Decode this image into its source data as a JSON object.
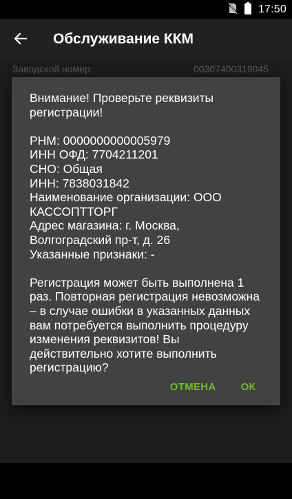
{
  "status_bar": {
    "time": "17:50"
  },
  "toolbar": {
    "title": "Обслуживание ККМ"
  },
  "serial": {
    "label": "Заводской номер:",
    "value": "00307400319045"
  },
  "dialog": {
    "heading_lines": [
      "Внимание! Проверьте реквизиты",
      "регистрации!"
    ],
    "details": [
      "РНМ: 0000000000005979",
      "ИНН ОФД: 7704211201",
      "СНО: Общая",
      "ИНН: 7838031842",
      "Наименование организации: ООО",
      "КАССОПТТОРГ",
      "Адрес магазина: г. Москва,",
      "Волгоградский пр-т, д. 26",
      "Указанные признаки: -"
    ],
    "message_lines": [
      "Регистрация может быть выполнена 1",
      "раз. Повторная регистрация невозможна",
      "– в случае ошибки в указанных данных",
      "вам потребуется выполнить процедуру",
      "изменения реквизитов! Вы",
      "действительно хотите выполнить",
      "регистрацию?"
    ],
    "cancel_label": "ОТМЕНА",
    "ok_label": "ОК"
  },
  "colors": {
    "accent": "#6dbb2f",
    "dialog_bg": "#424242",
    "toolbar_bg": "#212121"
  },
  "icons": {
    "back": "arrow-back-icon",
    "no_sim": "no-sim-icon",
    "battery": "battery-icon"
  }
}
